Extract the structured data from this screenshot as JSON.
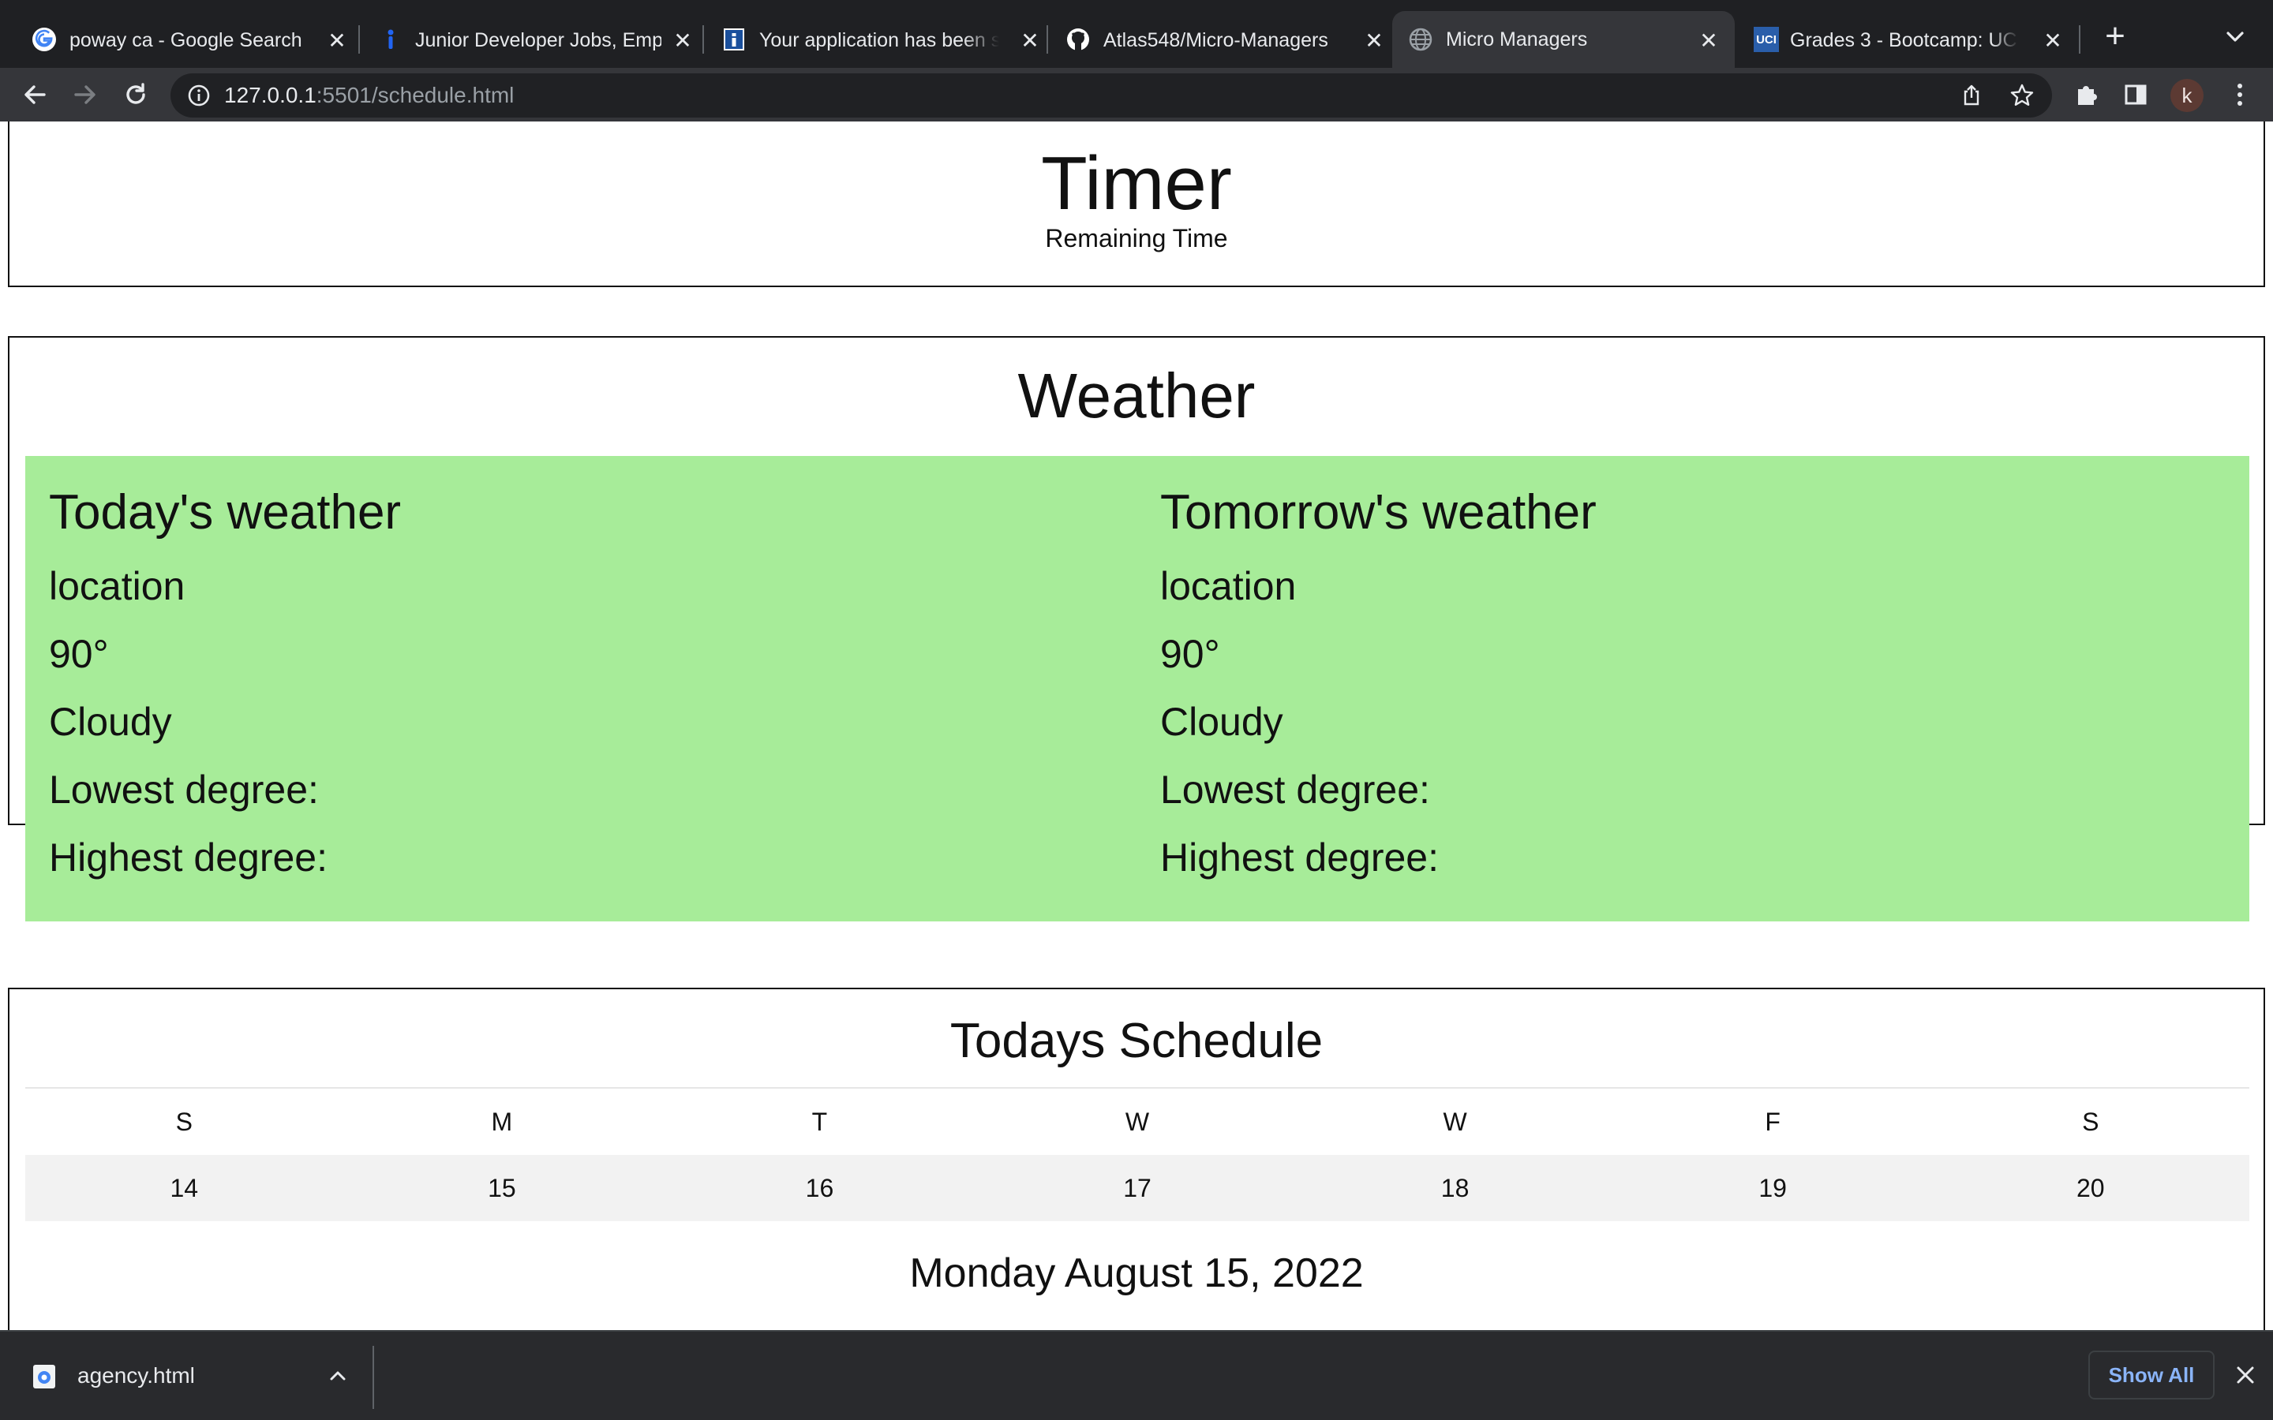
{
  "browser": {
    "tabs": [
      {
        "title": "poway ca - Google Search",
        "favicon": "google-icon"
      },
      {
        "title": "Junior Developer Jobs, Emp",
        "favicon": "indeed-icon"
      },
      {
        "title": "Your application has been s",
        "favicon": "info-icon"
      },
      {
        "title": "Atlas548/Micro-Managers",
        "favicon": "github-icon"
      },
      {
        "title": "Micro Managers",
        "favicon": "globe-icon",
        "active": true
      },
      {
        "title": "Grades 3 - Bootcamp: UCI-",
        "favicon": "uci-icon"
      }
    ],
    "uci_badge": "UCI",
    "new_tab": "+",
    "close_glyph": "✕",
    "address": {
      "host": "127.0.0.1",
      "rest": ":5501/schedule.html"
    },
    "profile_initial": "k"
  },
  "timer": {
    "title": "Timer",
    "subtitle": "Remaining Time"
  },
  "weather": {
    "title": "Weather",
    "bg_color": "#a7ec99",
    "today": {
      "heading": "Today's weather",
      "location": "location",
      "temperature": "90°",
      "condition": "Cloudy",
      "lowest": "Lowest degree:",
      "highest": "Highest degree:"
    },
    "tomorrow": {
      "heading": "Tomorrow's weather",
      "location": "location",
      "temperature": "90°",
      "condition": "Cloudy",
      "lowest": "Lowest degree:",
      "highest": "Highest degree:"
    }
  },
  "schedule": {
    "title": "Todays Schedule",
    "days": [
      "S",
      "M",
      "T",
      "W",
      "W",
      "F",
      "S"
    ],
    "dates": [
      "14",
      "15",
      "16",
      "17",
      "18",
      "19",
      "20"
    ],
    "current_date": "Monday August 15, 2022"
  },
  "downloads": {
    "file_name": "agency.html",
    "show_all": "Show All"
  }
}
